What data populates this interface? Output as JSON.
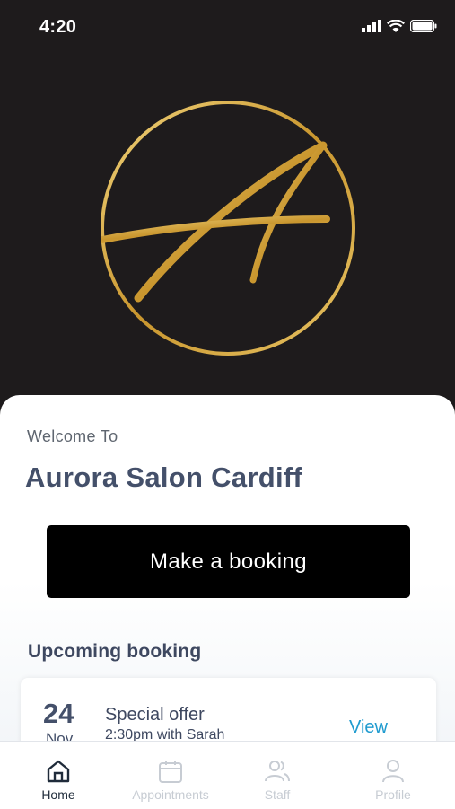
{
  "status": {
    "time": "4:20"
  },
  "welcome": {
    "label": "Welcome To",
    "salon_name": "Aurora Salon Cardiff"
  },
  "actions": {
    "book_label": "Make a booking"
  },
  "upcoming": {
    "heading": "Upcoming booking",
    "booking": {
      "day": "24",
      "month": "Nov",
      "title": "Special offer",
      "details": "2:30pm with Sarah",
      "view_label": "View"
    }
  },
  "tabs": [
    {
      "label": "Home",
      "icon": "home-icon",
      "active": true
    },
    {
      "label": "Appointments",
      "icon": "calendar-icon",
      "active": false
    },
    {
      "label": "Staff",
      "icon": "users-icon",
      "active": false
    },
    {
      "label": "Profile",
      "icon": "user-icon",
      "active": false
    }
  ],
  "colors": {
    "gold": "#d4a93c",
    "accent": "#1f9bcf",
    "heading": "#44506a",
    "hero_bg": "#1e1b1c"
  }
}
